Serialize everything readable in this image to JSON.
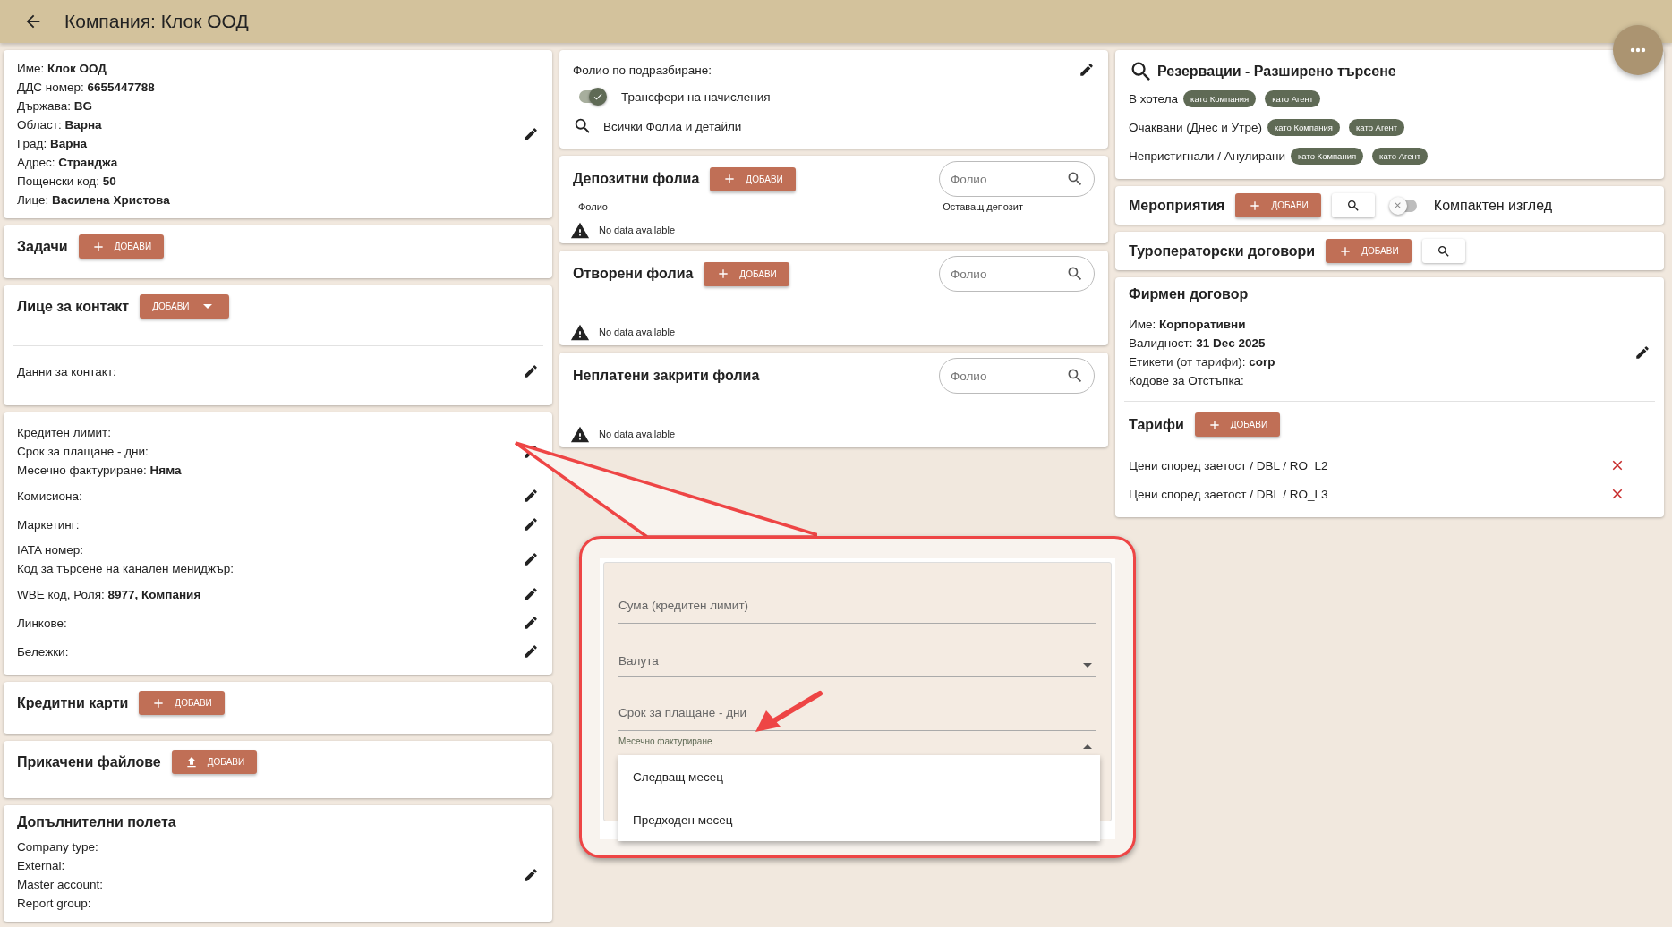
{
  "header": {
    "title": "Компания: Клок ООД"
  },
  "company": {
    "lines": [
      "Име: **Клок ООД**",
      "ДДС номер: **6655447788**",
      "Държава: **BG**",
      "Област: **Варна**",
      "Град: **Варна**",
      "Адрес: **Странджа**",
      "Пощенски код: **50**",
      "Лице: **Василена Христова**"
    ]
  },
  "tasks": {
    "title": "Задачи",
    "add_button": "ДОБАВИ"
  },
  "contacts": {
    "title": "Лице за контакт",
    "add_button": "ДОБАВИ",
    "details": "Данни за контакт:"
  },
  "credit": {
    "groups": [
      {
        "lines": [
          "Кредитен лимит:",
          "Срок за плащане - дни:",
          "Месечно фактуриране: **Няма**"
        ]
      },
      {
        "lines": [
          "Комисиона:"
        ]
      },
      {
        "lines": [
          "Маркетинг:"
        ]
      },
      {
        "lines": [
          "IATA номер:",
          "Код за търсене на канален мениджър:"
        ]
      },
      {
        "lines": [
          "WBE код, Роля: **8977, Компания**"
        ]
      },
      {
        "lines": [
          "Линкове:"
        ]
      },
      {
        "lines": [
          "Бележки:"
        ]
      }
    ]
  },
  "credit_cards": {
    "title": "Кредитни карти",
    "add_button": "ДОБАВИ"
  },
  "attachments": {
    "title": "Прикачени файлове",
    "add_button": "ДОБАВИ"
  },
  "extra_fields": {
    "title": "Допълнителни полета",
    "lines": [
      "Company type:",
      "External:",
      "Master account:",
      "Report group:"
    ]
  },
  "folio_settings": {
    "default_label": "Фолио по подразбиране:",
    "transfer_toggle": {
      "label": "Трансфери на начисления",
      "on": true
    },
    "all_link": "Всички Фолиа и детайли"
  },
  "folio_sections": [
    {
      "title": "Депозитни фолиа",
      "add_button": "ДОБАВИ",
      "search_placeholder": "Фолио",
      "columns": [
        "Фолио",
        "Оставащ депозит"
      ],
      "empty": "No data available"
    },
    {
      "title": "Отворени фолиа",
      "add_button": "ДОБАВИ",
      "search_placeholder": "Фолио",
      "empty": "No data available"
    },
    {
      "title": "Неплатени закрити фолиа",
      "search_placeholder": "Фолио",
      "empty": "No data available"
    }
  ],
  "reservations": {
    "title": "Резервации - Разширено търсене",
    "rows": [
      {
        "label": "В хотела",
        "chips": [
          "като Компания",
          "като Агент"
        ]
      },
      {
        "label": "Очаквани (Днес и Утре)",
        "chips": [
          "като Компания",
          "като Агент"
        ]
      },
      {
        "label": "Непристигнали / Анулирани",
        "chips": [
          "като Компания",
          "като Агент"
        ]
      }
    ]
  },
  "events": {
    "title": "Мероприятия",
    "add_button": "ДОБАВИ",
    "compact_toggle": {
      "label": "Компактен изглед",
      "on": false
    }
  },
  "tour_contracts": {
    "title": "Туроператорски договори",
    "add_button": "ДОБАВИ"
  },
  "company_contract": {
    "title": "Фирмен договор",
    "lines": [
      "Име: **Корпоративни**",
      "Валидност: **31 Dec 2025**",
      "Етикети (от тарифи): **corp**",
      "Кодове за Отстъпка:"
    ],
    "tariffs_title": "Тарифи",
    "add_button": "ДОБАВИ",
    "tariffs": [
      "Цени според заетост / DBL / RO_L2",
      "Цени според заетост / DBL / RO_L3"
    ]
  },
  "callout": {
    "fields": [
      {
        "kind": "text",
        "placeholder": "Сума (кредитен лимит)"
      },
      {
        "kind": "select",
        "placeholder": "Валута"
      },
      {
        "kind": "text",
        "placeholder": "Срок за плащане - дни"
      },
      {
        "kind": "open_select",
        "label": "Месечно фактуриране",
        "options": [
          "Следващ месец",
          "Предходен месец"
        ]
      }
    ]
  }
}
